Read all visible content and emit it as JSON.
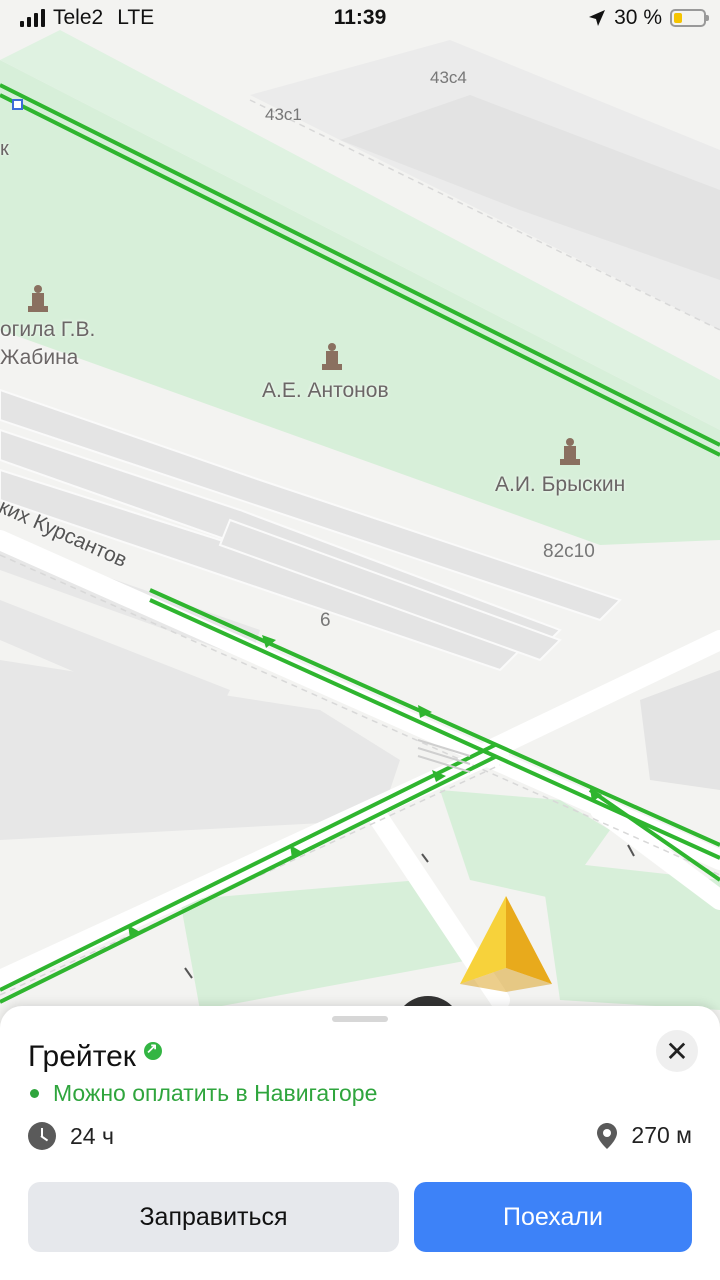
{
  "status_bar": {
    "carrier": "Tele2",
    "network": "LTE",
    "time": "11:39",
    "battery": "30 %",
    "battery_level": 0.3
  },
  "map": {
    "labels": {
      "poi_1": "огила Г.В.",
      "poi_1_line2": "Жабина",
      "poi_2": "А.Е. Антонов",
      "poi_3": "А.И. Брыскин",
      "house_1": "43с4",
      "house_2": "43с1",
      "house_3": "82с10",
      "house_4": "6",
      "street": "ких Курсантов",
      "edge_letter": "к"
    },
    "icons": [
      "monument-icon",
      "navigation-arrow-icon"
    ]
  },
  "place_card": {
    "title": "Грейтек",
    "payment_status": "Можно оплатить в Навигаторе",
    "hours": "24 ч",
    "distance": "270 м",
    "refuel_button": "Заправиться",
    "go_button": "Поехали",
    "colors": {
      "accent_green": "#2fa53d",
      "go_blue": "#3d82f8"
    }
  }
}
